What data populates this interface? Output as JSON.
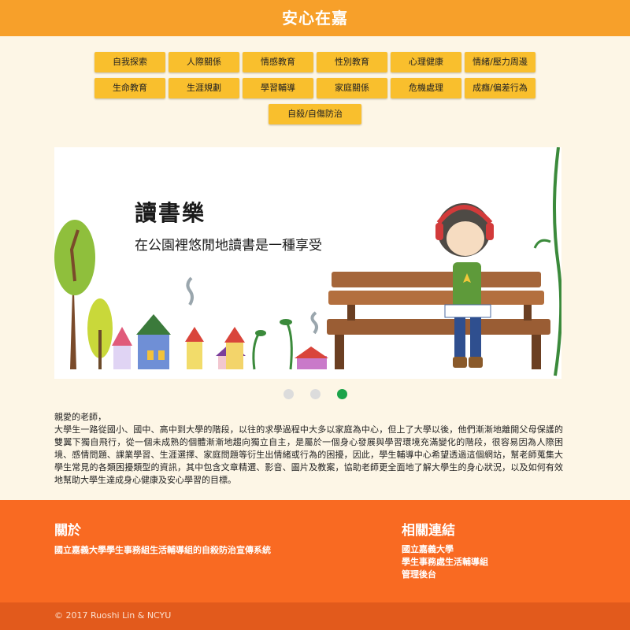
{
  "header": {
    "title": "安心在嘉"
  },
  "categories": {
    "row1": [
      "自我探索",
      "人際關係",
      "情感教育",
      "性別教育",
      "心理健康",
      "情緒/壓力周邊"
    ],
    "row2": [
      "生命教育",
      "生涯規劃",
      "學習輔導",
      "家庭關係",
      "危機處理",
      "成癮/偏差行為"
    ],
    "row3": [
      "自殺/自傷防治"
    ]
  },
  "carousel": {
    "slide_title": "讀書樂",
    "slide_subtitle": "在公園裡悠閒地讀書是一種享受",
    "slide_count": 3,
    "active_index": 2
  },
  "intro": {
    "greeting": "親愛的老師，",
    "body": "大學生一路從國小、國中、高中到大學的階段，以往的求學過程中大多以家庭為中心，但上了大學以後，他們漸漸地離開父母保護的雙翼下獨自飛行，從一個未成熟的個體漸漸地趨向獨立自主，是屬於一個身心發展與學習環境充滿變化的階段，很容易因為人際困境、感情問題、課業學習、生涯選擇、家庭問題等衍生出情緒或行為的困擾，因此，學生輔導中心希望透過這個網站，幫老師蒐集大學生常見的各類困擾類型的資訊，其中包含文章精選、影音、圖片及教案，協助老師更全面地了解大學生的身心狀況，以及如何有效地幫助大學生達成身心健康及安心學習的目標。"
  },
  "footer": {
    "about_heading": "關於",
    "about_text": "國立嘉義大學學生事務組生活輔導組的自殺防治宣傳系統",
    "links_heading": "相關連結",
    "links": [
      "國立嘉義大學",
      "學生事務處生活輔導組",
      "管理後台"
    ],
    "copyright": "© 2017 Ruoshi Lin & NCYU"
  },
  "colors": {
    "header_bg": "#f7a02a",
    "button_bg": "#f9bf2d",
    "page_bg": "#fdf6e6",
    "footer_bg": "#f96a22",
    "bottombar_bg": "#e25a1c",
    "active_dot": "#1ba34a"
  }
}
